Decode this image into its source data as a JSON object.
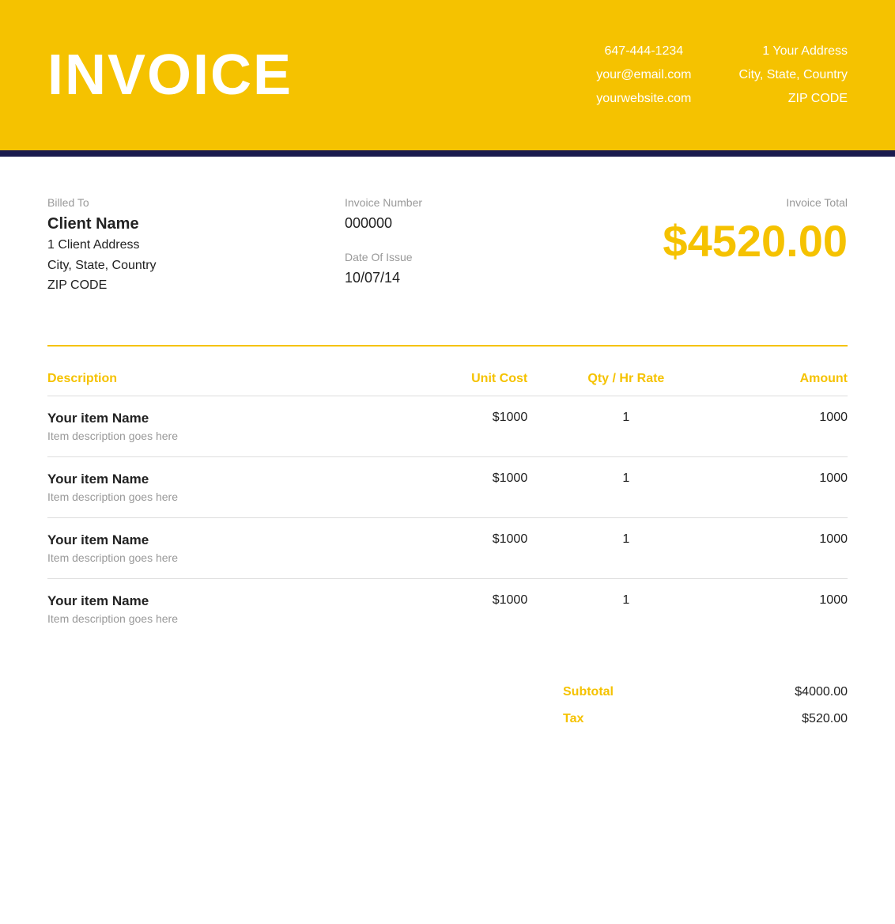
{
  "header": {
    "title": "INVOICE",
    "phone": "647-444-1234",
    "email": "your@email.com",
    "website": "yourwebsite.com",
    "address_line1": "1 Your Address",
    "address_line2": "City, State, Country",
    "zip": "ZIP CODE"
  },
  "billing": {
    "billed_to_label": "Billed To",
    "client_name": "Client Name",
    "client_address": "1 Client Address",
    "client_city": "City, State, Country",
    "client_zip": "ZIP CODE",
    "invoice_number_label": "Invoice Number",
    "invoice_number": "000000",
    "date_of_issue_label": "Date Of Issue",
    "date_of_issue": "10/07/14",
    "invoice_total_label": "Invoice Total",
    "invoice_total": "$4520.00"
  },
  "table": {
    "col_description": "Description",
    "col_unit_cost": "Unit Cost",
    "col_qty": "Qty / Hr Rate",
    "col_amount": "Amount",
    "rows": [
      {
        "name": "Your item Name",
        "description": "Item description goes here",
        "unit_cost": "$1000",
        "qty": "1",
        "amount": "1000"
      },
      {
        "name": "Your item Name",
        "description": "Item description goes here",
        "unit_cost": "$1000",
        "qty": "1",
        "amount": "1000"
      },
      {
        "name": "Your item Name",
        "description": "Item description goes here",
        "unit_cost": "$1000",
        "qty": "1",
        "amount": "1000"
      },
      {
        "name": "Your item Name",
        "description": "Item description goes here",
        "unit_cost": "$1000",
        "qty": "1",
        "amount": "1000"
      }
    ]
  },
  "summary": {
    "subtotal_label": "Subtotal",
    "subtotal_value": "$4000.00",
    "tax_label": "Tax",
    "tax_value": "$520.00"
  }
}
